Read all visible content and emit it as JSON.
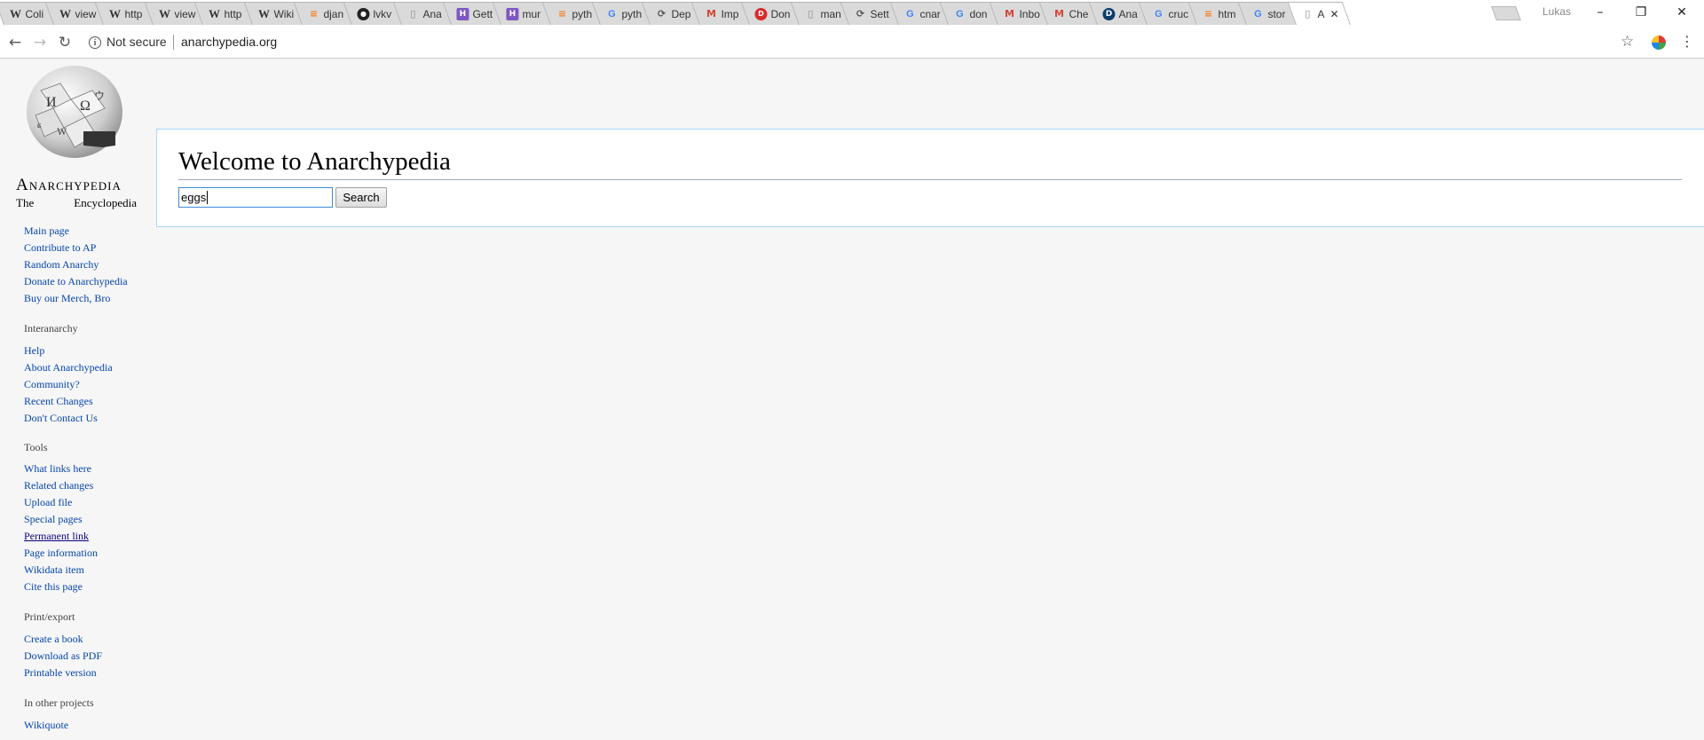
{
  "browser": {
    "tabs": [
      {
        "icon": "wikipedia-icon",
        "title": "Coli"
      },
      {
        "icon": "wikipedia-icon",
        "title": "view"
      },
      {
        "icon": "wikipedia-icon",
        "title": "http"
      },
      {
        "icon": "wikipedia-icon",
        "title": "view"
      },
      {
        "icon": "wikipedia-icon",
        "title": "http"
      },
      {
        "icon": "wikipedia-icon",
        "title": "Wiki"
      },
      {
        "icon": "stackoverflow-icon",
        "title": "djan"
      },
      {
        "icon": "github-icon",
        "title": "lvkv"
      },
      {
        "icon": "document-icon",
        "title": "Ana"
      },
      {
        "icon": "heroku-icon",
        "title": "Gett"
      },
      {
        "icon": "heroku-icon",
        "title": "mur"
      },
      {
        "icon": "stackoverflow-icon",
        "title": "pyth"
      },
      {
        "icon": "google-icon",
        "title": "pyth"
      },
      {
        "icon": "deploy-icon",
        "title": "Dep"
      },
      {
        "icon": "gmail-icon",
        "title": "Imp"
      },
      {
        "icon": "domain-icon",
        "title": "Don"
      },
      {
        "icon": "document-icon",
        "title": "man"
      },
      {
        "icon": "deploy-icon",
        "title": "Sett"
      },
      {
        "icon": "google-icon",
        "title": "cnar"
      },
      {
        "icon": "google-icon",
        "title": "don"
      },
      {
        "icon": "gmail-icon",
        "title": "Inbo"
      },
      {
        "icon": "gmail-icon",
        "title": "Che"
      },
      {
        "icon": "digitalocean-icon",
        "title": "Ana"
      },
      {
        "icon": "google-icon",
        "title": "cruc"
      },
      {
        "icon": "stackoverflow-icon",
        "title": "htm"
      },
      {
        "icon": "google-icon",
        "title": "stor"
      },
      {
        "icon": "document-icon",
        "title": "A",
        "active": true
      }
    ],
    "user_name": "Lukas",
    "address": {
      "security_label": "Not secure",
      "url": "anarchypedia.org"
    }
  },
  "site": {
    "name": "Anarchypedia",
    "tagline_left": "The",
    "tagline_right": "Encyclopedia",
    "sidebar": {
      "navigation": [
        "Main page",
        "Contribute to AP",
        "Random Anarchy",
        "Donate to Anarchypedia",
        "Buy our Merch, Bro"
      ],
      "interanarchy": {
        "heading": "Interanarchy",
        "items": [
          "Help",
          "About Anarchypedia",
          "Community?",
          "Recent Changes",
          "Don't Contact Us"
        ]
      },
      "tools": {
        "heading": "Tools",
        "items": [
          "What links here",
          "Related changes",
          "Upload file",
          "Special pages",
          "Permanent link",
          "Page information",
          "Wikidata item",
          "Cite this page"
        ]
      },
      "print_export": {
        "heading": "Print/export",
        "items": [
          "Create a book",
          "Download as PDF",
          "Printable version"
        ]
      },
      "other_projects": {
        "heading": "In other projects",
        "items": [
          "Wikiquote"
        ]
      }
    }
  },
  "main": {
    "title": "Welcome to Anarchypedia",
    "search": {
      "value": "eggs",
      "button_label": "Search"
    }
  },
  "colors": {
    "link": "#0645ad",
    "visited_link": "#0b0080",
    "content_border": "#a7d7f9",
    "page_background": "#f6f6f6"
  }
}
